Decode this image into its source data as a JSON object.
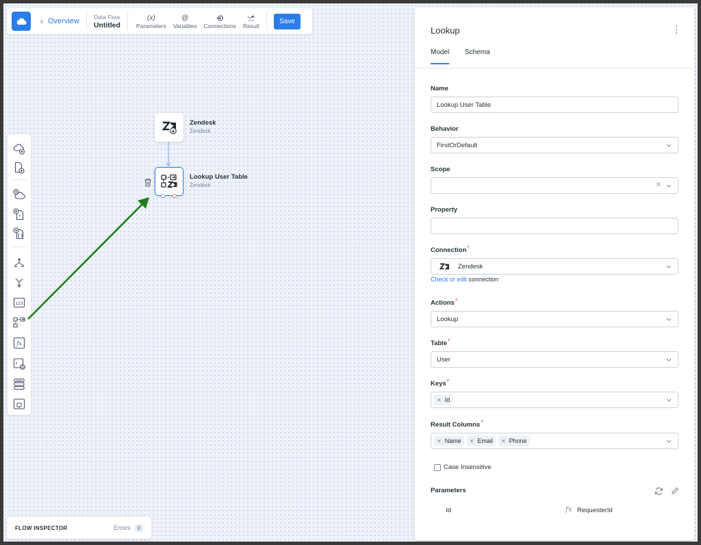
{
  "toolbar": {
    "back_label": "Overview",
    "flow_kind": "Data Flow",
    "flow_name": "Untitled",
    "tools": [
      {
        "label": "Parameters",
        "icon": "(x)"
      },
      {
        "label": "Variables",
        "icon": "@"
      },
      {
        "label": "Connections",
        "icon": "connections-icon"
      },
      {
        "label": "Result",
        "icon": "result-icon"
      }
    ],
    "save_label": "Save"
  },
  "canvas": {
    "nodes": [
      {
        "title": "Zendesk",
        "subtitle": "Zendesk"
      },
      {
        "title": "Lookup User Table",
        "subtitle": "Zendesk"
      }
    ]
  },
  "inspector": {
    "title": "FLOW INSPECTOR",
    "errors_label": "Errors",
    "errors_count": "0"
  },
  "panel": {
    "title": "Lookup",
    "tabs": [
      "Model",
      "Schema"
    ],
    "name_label": "Name",
    "name_value": "Lookup User Table",
    "behavior_label": "Behavior",
    "behavior_value": "FirstOrDefault",
    "scope_label": "Scope",
    "scope_value": "",
    "property_label": "Property",
    "property_value": "",
    "connection_label": "Connection",
    "connection_value": "Zendesk",
    "check_link": "Check or edit",
    "check_suffix": "connection",
    "actions_label": "Actions",
    "actions_value": "Lookup",
    "table_label": "Table",
    "table_value": "User",
    "keys_label": "Keys",
    "keys": [
      "Id"
    ],
    "result_label": "Result Columns",
    "result_columns": [
      "Name",
      "Email",
      "Phone"
    ],
    "case_label": "Case Insensitive",
    "parameters_label": "Parameters",
    "param_name": "Id",
    "param_fx": "fx",
    "param_value": "RequesterId",
    "required_mark": "*"
  },
  "colors": {
    "accent": "#2b7de9",
    "arrow": "#217a1c",
    "canvas": "#eef2fa"
  }
}
